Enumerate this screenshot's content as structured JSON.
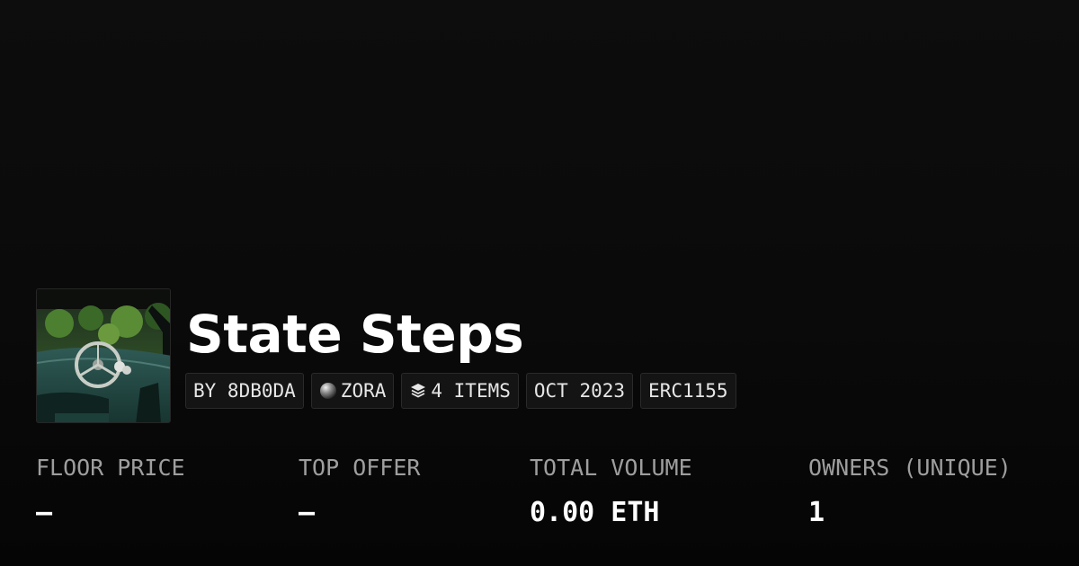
{
  "collection": {
    "title": "State Steps",
    "thumbnail_alt": "collection artwork: abandoned vintage car interior with steering wheel",
    "tags": {
      "creator": "BY 8DB0DA",
      "chain": "ZORA",
      "chain_icon": "zora-orb-icon",
      "items": "4 ITEMS",
      "items_icon": "layers-icon",
      "date": "OCT 2023",
      "standard": "ERC1155"
    }
  },
  "stats": {
    "floor_price": {
      "label": "FLOOR PRICE",
      "value": "–"
    },
    "top_offer": {
      "label": "TOP OFFER",
      "value": "–"
    },
    "total_volume": {
      "label": "TOTAL VOLUME",
      "value": "0.00 ETH"
    },
    "owners": {
      "label": "OWNERS (UNIQUE)",
      "value": "1"
    }
  },
  "colors": {
    "background": "#0a0a0a",
    "text_primary": "#ffffff",
    "text_secondary": "#9e9e9e",
    "tag_background": "#141414",
    "tag_border": "#2a2a2a"
  }
}
